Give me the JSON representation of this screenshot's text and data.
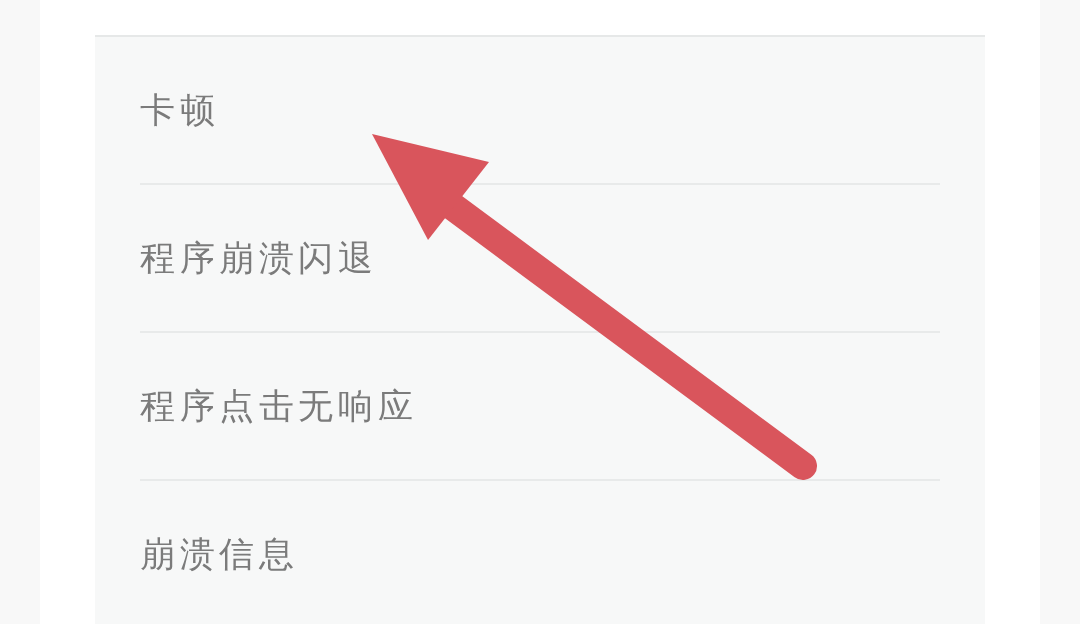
{
  "list": {
    "items": [
      {
        "label": "卡顿"
      },
      {
        "label": "程序崩溃闪退"
      },
      {
        "label": "程序点击无响应"
      },
      {
        "label": "崩溃信息"
      }
    ]
  },
  "annotations": [
    {
      "kind": "arrow"
    }
  ]
}
